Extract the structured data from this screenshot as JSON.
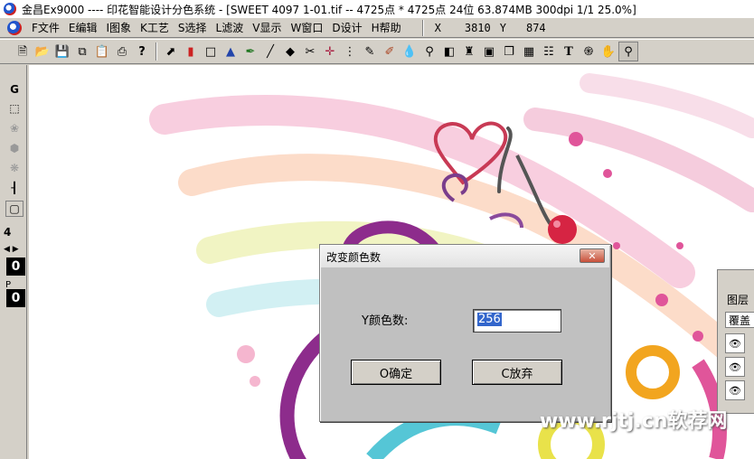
{
  "window": {
    "title": "金昌Ex9000 ---- 印花智能设计分色系统 - [SWEET 4097 1-01.tif -- 4725点 * 4725点 24位  63.874MB 300dpi 1/1  25.0%]"
  },
  "menubar": {
    "items": [
      "F文件",
      "E编辑",
      "I图象",
      "K工艺",
      "S选择",
      "L滤波",
      "V显示",
      "W窗口",
      "D设计",
      "H帮助"
    ],
    "x_label": "X",
    "x_value": "3810",
    "y_label": "Y",
    "y_value": "874"
  },
  "toolbar": {
    "icons": [
      "new-file-icon",
      "open-folder-icon",
      "save-icon",
      "copy-icon",
      "paste-icon",
      "print-icon",
      "help-icon",
      "pointer-icon",
      "eraser-icon",
      "rectangle-icon",
      "tone-icon",
      "brush-icon",
      "line-icon",
      "fill-icon",
      "scissors-icon",
      "move-icon",
      "spray-icon",
      "eyedropper-icon",
      "pen-icon",
      "drop-icon",
      "magic-wand-icon",
      "gradient-icon",
      "stamp-icon",
      "frame-icon",
      "layers-icon",
      "texture-icon",
      "grid-icon",
      "text-icon",
      "spiral-icon",
      "hand-icon",
      "zoom-icon"
    ]
  },
  "left_panel": {
    "tool_g": "G",
    "value_4": "4",
    "value_top": "0",
    "p_label": "P",
    "value_bottom": "0"
  },
  "layers": {
    "title": "图层",
    "layer_name": "覆盖"
  },
  "dialog": {
    "title": "改变颜色数",
    "close_label": "✕",
    "field_label": "Y颜色数:",
    "field_value": "256",
    "ok_label": "O确定",
    "cancel_label": "C放弃"
  },
  "watermark": {
    "text": "www.rjtj.cn软荐网"
  },
  "colors": {
    "chrome": "#d4d0c8",
    "dialog_bg": "#c0c0c0",
    "selection": "#3366cc",
    "black_field": "#000000"
  }
}
